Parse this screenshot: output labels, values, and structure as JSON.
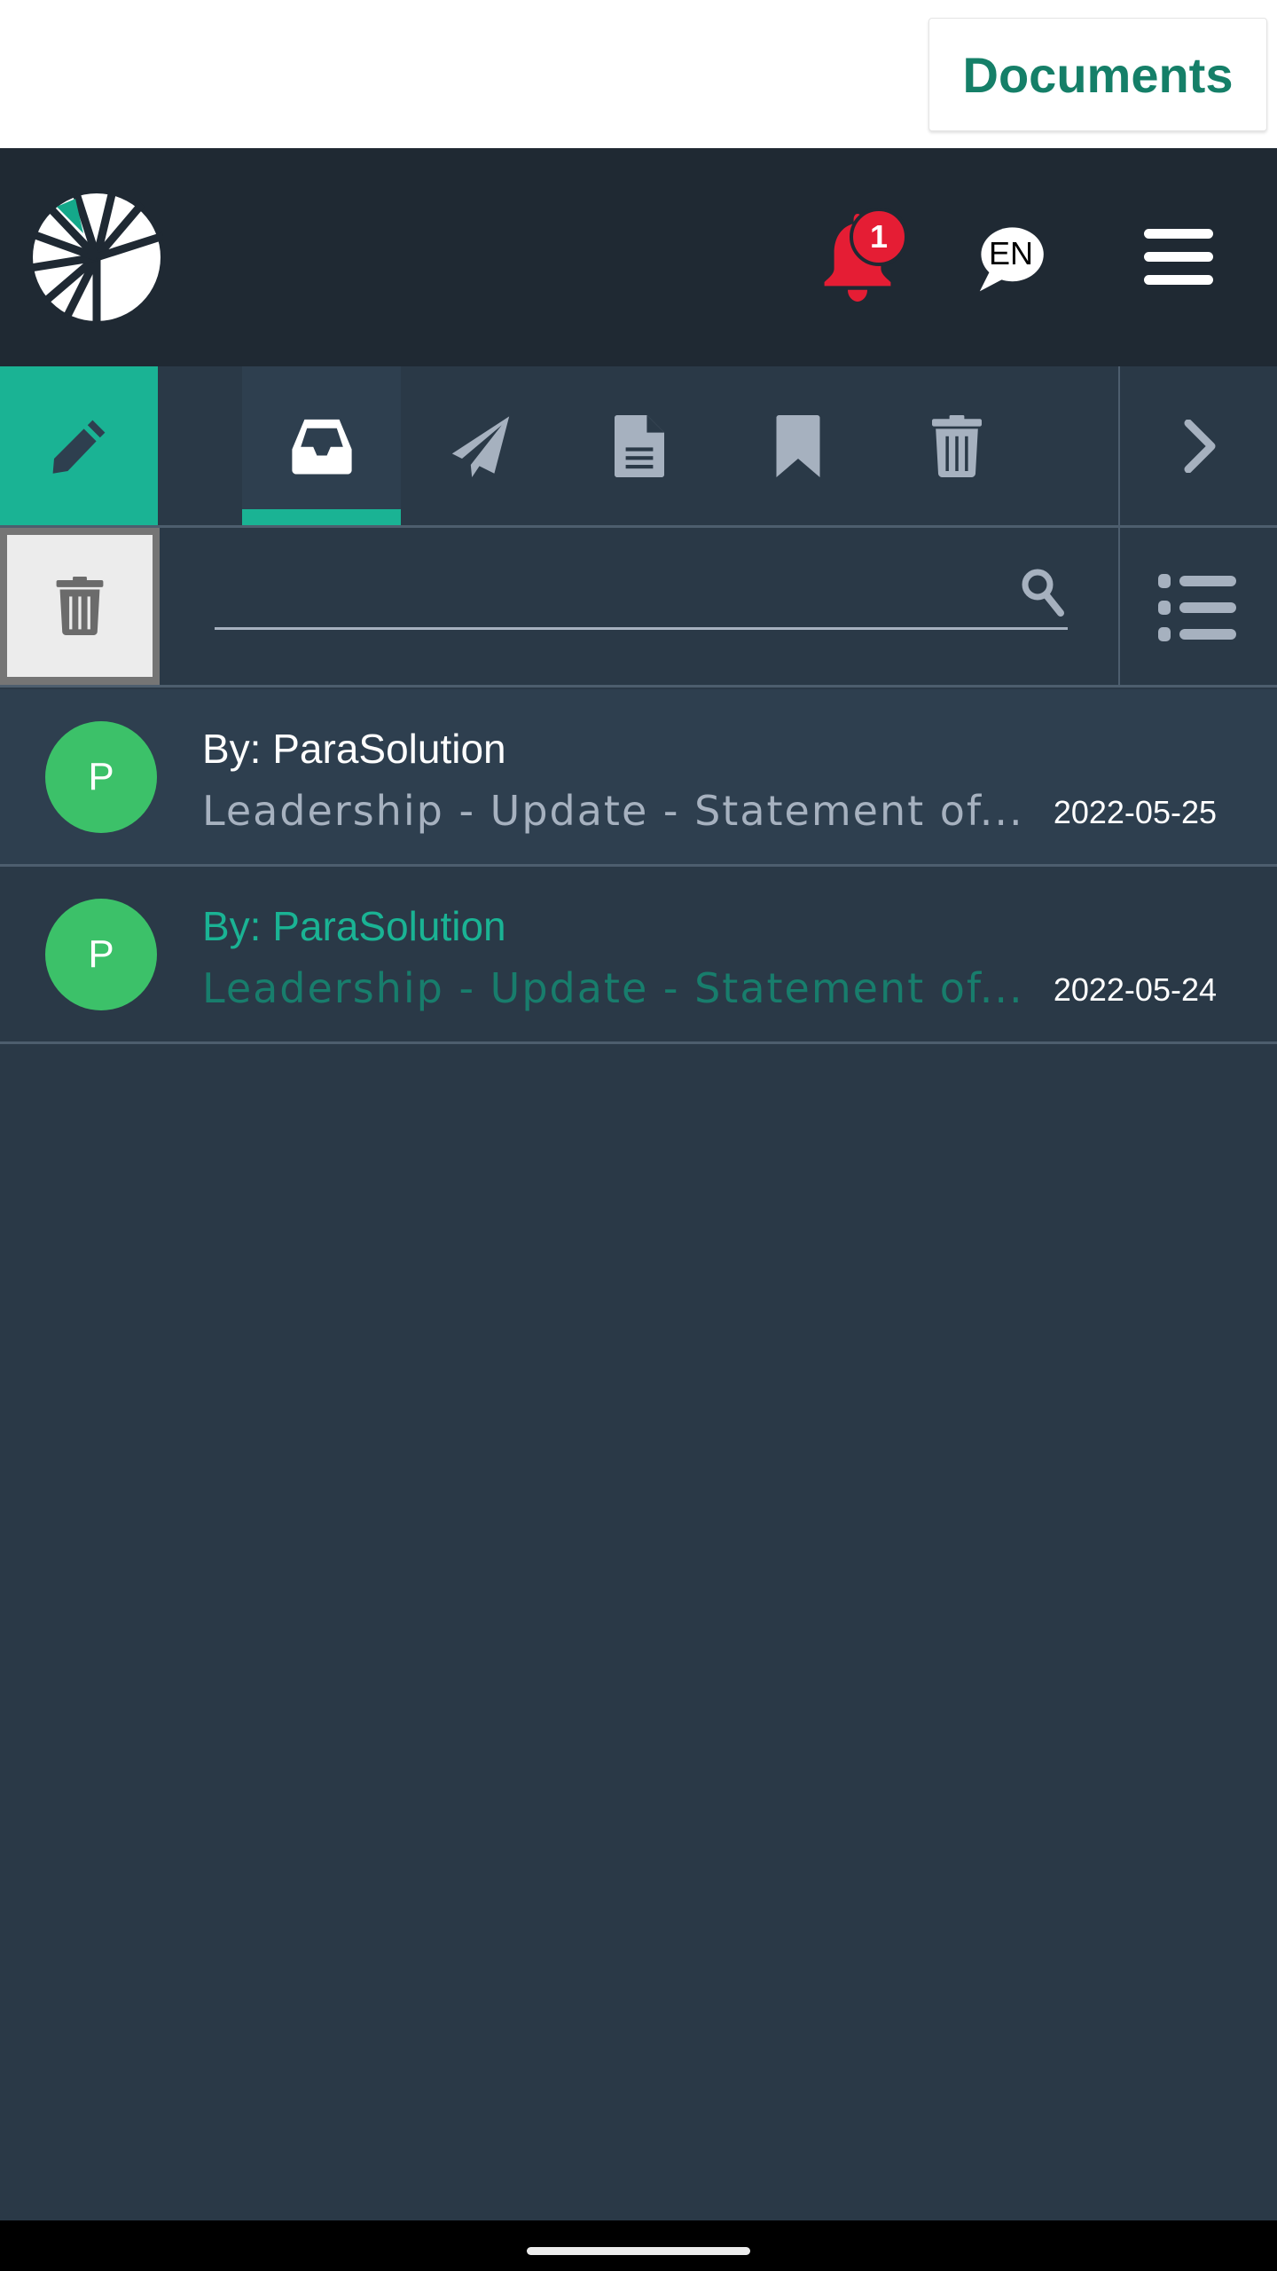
{
  "topbar": {
    "documents_button": "Documents"
  },
  "header": {
    "logo": "pie-chart-logo",
    "notifications": {
      "icon": "bell-icon",
      "count": "1"
    },
    "language": {
      "icon": "speech-bubble-icon",
      "label": "EN"
    },
    "menu": {
      "icon": "hamburger-menu-icon"
    }
  },
  "tabs": {
    "compose": {
      "icon": "pencil-icon"
    },
    "items": [
      {
        "icon": "inbox-icon",
        "active": true
      },
      {
        "icon": "paper-plane-icon",
        "active": false
      },
      {
        "icon": "document-icon",
        "active": false
      },
      {
        "icon": "bookmark-icon",
        "active": false
      },
      {
        "icon": "trash-icon",
        "active": false
      }
    ],
    "more": {
      "icon": "chevron-right-icon"
    }
  },
  "search": {
    "delete_icon": "trash-icon",
    "value": "",
    "placeholder": "",
    "search_icon": "search-icon",
    "view_icon": "list-view-icon"
  },
  "messages": [
    {
      "avatar": "P",
      "sender": "By: ParaSolution",
      "subject": "Leadership - Update - Statement of...",
      "date": "2022-05-25",
      "read": false
    },
    {
      "avatar": "P",
      "sender": "By: ParaSolution",
      "subject": "Leadership - Update - Statement of...",
      "date": "2022-05-24",
      "read": true
    }
  ],
  "colors": {
    "accent": "#1ab394",
    "header_bg": "#1f2933",
    "content_bg": "#2a3947",
    "notification": "#e51d34",
    "avatar": "#3cc169",
    "documents_text": "#157f68"
  }
}
